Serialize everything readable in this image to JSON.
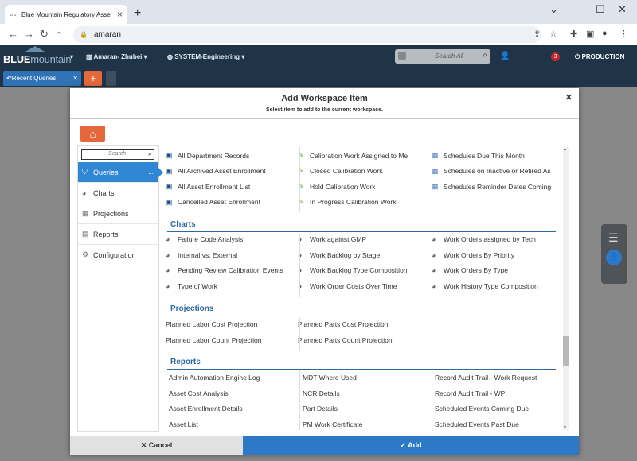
{
  "browser": {
    "tab_title": "Blue Mountain Regulatory Asse",
    "url": "amaran"
  },
  "app": {
    "logo_a": "BLUE",
    "logo_b": "mountain",
    "user": "Amaran- Zhubei",
    "system": "SYSTEM-Engineering",
    "search_placeholder": "Search All",
    "badge": "3",
    "environment": "PRODUCTION",
    "tab_label": "Recent Queries"
  },
  "modal": {
    "title": "Add Workspace Item",
    "subtitle": "Select item to add to the current workspace.",
    "search_placeholder": "Search",
    "cancel_label": "Cancel",
    "add_label": "Add"
  },
  "sidebar": [
    {
      "label": "Queries",
      "icon": "filter-icon",
      "active": true
    },
    {
      "label": "Charts",
      "icon": "pie-icon"
    },
    {
      "label": "Projections",
      "icon": "grid-icon"
    },
    {
      "label": "Reports",
      "icon": "report-icon"
    },
    {
      "label": "Configuration",
      "icon": "wrench-icon"
    }
  ],
  "queries": {
    "col1": [
      "All Department Records",
      "All Archived Asset Enrollment",
      "All Asset Enrollment List",
      "Cancelled Asset Enrollment"
    ],
    "col2": [
      "Calibration Work Assigned to Me",
      "Closed Calibration Work",
      "Hold Calibration Work",
      "In Progress Calibration Work"
    ],
    "col3": [
      "Schedules Due This Month",
      "Schedules on Inactive or Retired As",
      "Schedules Reminder Dates Coming"
    ]
  },
  "charts": {
    "title": "Charts",
    "col1": [
      "Failure Code Analysis",
      "Internal vs. External",
      "Pending Review Calibration Events",
      "Type of Work"
    ],
    "col2": [
      "Work against GMP",
      "Work Backlog by Stage",
      "Work Backlog Type Composition",
      "Work Order Costs Over Time"
    ],
    "col3": [
      "Work Orders assigned by Tech",
      "Work Orders By Priority",
      "Work Orders By Type",
      "Work History Type Composition"
    ]
  },
  "projections": {
    "title": "Projections",
    "col1": [
      "Planned Labor Cost Projection",
      "Planned Labor Count Projection"
    ],
    "col2": [
      "Planned Parts Cost Projection",
      "Planned Parts Count Projection"
    ]
  },
  "reports": {
    "title": "Reports",
    "col1": [
      "Admin Automation Engine Log",
      "Asset Cost Analysis",
      "Asset Enrollment Details",
      "Asset List"
    ],
    "col2": [
      "MDT Where Used",
      "NCR Details",
      "Part Details",
      "PM Work Certificate"
    ],
    "col3": [
      "Record Audit Trail - Work Request",
      "Record Audit Trail - WP",
      "Scheduled Events Coming Due",
      "Scheduled Events Past Due"
    ]
  }
}
